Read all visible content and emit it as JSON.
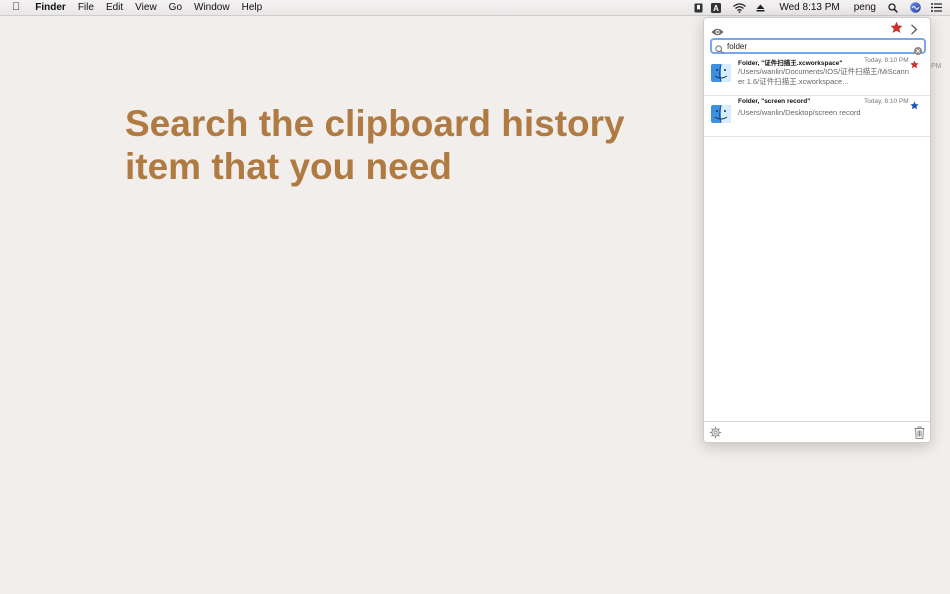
{
  "menubar": {
    "apple_icon": "apple-icon",
    "app_name": "Finder",
    "items": [
      "File",
      "Edit",
      "View",
      "Go",
      "Window",
      "Help"
    ],
    "status_icons": [
      "bookmark-icon",
      "keyboard-input-icon",
      "wifi-icon",
      "eject-icon"
    ],
    "clock": "Wed 8:13 PM",
    "user": "peng",
    "extra_icons": [
      "spotlight-icon",
      "siri-icon",
      "notification-list-icon"
    ]
  },
  "headline": {
    "line1": "Search the clipboard history",
    "line2": "item that you need"
  },
  "panel": {
    "search": {
      "value": "folder"
    },
    "items": [
      {
        "title": "Folder, \"证件扫描王.xcworkspace\"",
        "time": "Today, 8:10 PM",
        "path": "/Users/wanlin/Documents/IOS/证件扫描王/MiScanner 1.6/证件扫描王.xcworkspace...",
        "star_color": "#d0312d"
      },
      {
        "title": "Folder, \"screen record\"",
        "time": "Today, 8:10 PM",
        "path": "/Users/wanlin/Desktop/screen record",
        "star_color": "#1f55b5"
      }
    ]
  },
  "side_text": "PM",
  "colors": {
    "background": "#f1eeeb",
    "headline": "#b07a43",
    "favorite_red": "#d0312d",
    "favorite_blue": "#1f55b5",
    "search_focus": "#7aa7e6"
  }
}
